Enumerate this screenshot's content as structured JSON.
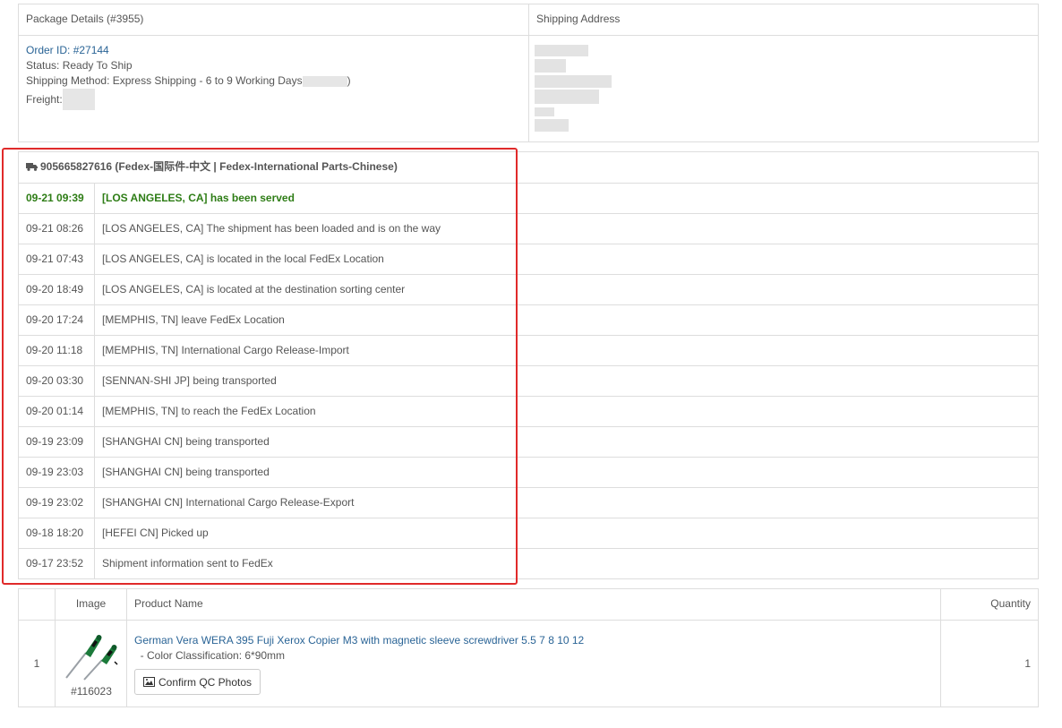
{
  "package": {
    "title": "Package Details (#3955)",
    "shipping_address_label": "Shipping Address",
    "order_id_label": "Order ID: ",
    "order_id": "#27144",
    "status_line": "Status: Ready To Ship",
    "shipping_method": "Shipping Method: Express Shipping - 6 to 9 Working Days",
    "shipping_method_tail": ")",
    "freight_label": "Freight:"
  },
  "tracking": {
    "header": "905665827616 (Fedex-国际件-中文 | Fedex-International Parts-Chinese)",
    "events": [
      {
        "time": "09-21 09:39",
        "event": "[LOS ANGELES, CA] has been served"
      },
      {
        "time": "09-21 08:26",
        "event": "[LOS ANGELES, CA] The shipment has been loaded and is on the way"
      },
      {
        "time": "09-21 07:43",
        "event": "[LOS ANGELES, CA] is located in the local FedEx Location"
      },
      {
        "time": "09-20 18:49",
        "event": "[LOS ANGELES, CA] is located at the destination sorting center"
      },
      {
        "time": "09-20 17:24",
        "event": "[MEMPHIS, TN] leave FedEx Location"
      },
      {
        "time": "09-20 11:18",
        "event": "[MEMPHIS, TN] International Cargo Release-Import"
      },
      {
        "time": "09-20 03:30",
        "event": "[SENNAN-SHI JP] being transported"
      },
      {
        "time": "09-20 01:14",
        "event": "[MEMPHIS, TN] to reach the FedEx Location"
      },
      {
        "time": "09-19 23:09",
        "event": "[SHANGHAI CN] being transported"
      },
      {
        "time": "09-19 23:03",
        "event": "[SHANGHAI CN] being transported"
      },
      {
        "time": "09-19 23:02",
        "event": "[SHANGHAI CN] International Cargo Release-Export"
      },
      {
        "time": "09-18 18:20",
        "event": "[HEFEI CN] Picked up"
      },
      {
        "time": "09-17 23:52",
        "event": "Shipment information sent to FedEx"
      }
    ]
  },
  "products": {
    "headers": {
      "image": "Image",
      "name": "Product Name",
      "quantity": "Quantity"
    },
    "rows": [
      {
        "index": "1",
        "product_id": "#116023",
        "name": "German Vera WERA 395 Fuji Xerox Copier M3 with magnetic sleeve screwdriver 5.5 7 8 10 12",
        "variant": "  - Color Classification: 6*90mm",
        "qc_button": "Confirm QC Photos",
        "quantity": "1"
      }
    ]
  },
  "colors": {
    "link": "#2a6496",
    "latest_event": "#2e7d16",
    "highlight_border": "#e02a2a",
    "border": "#dddddd"
  }
}
